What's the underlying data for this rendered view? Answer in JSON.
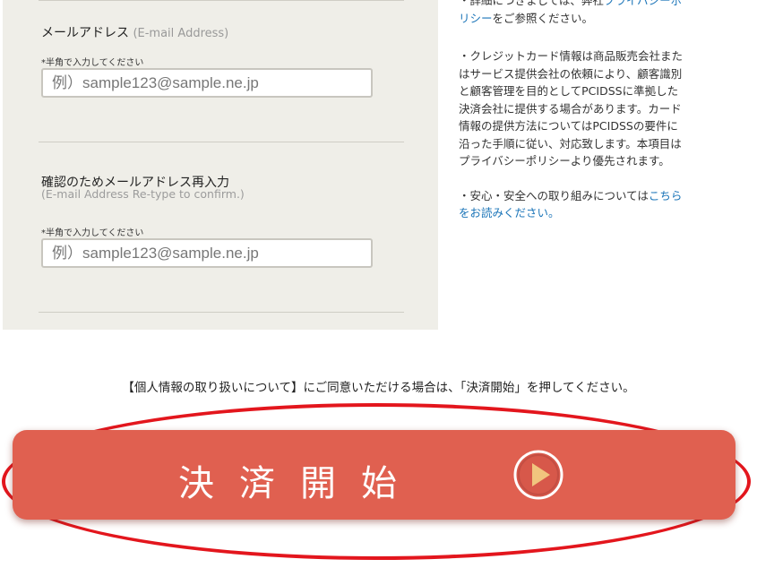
{
  "email_section": {
    "label": "メールアドレス",
    "label_en": "(E-mail Address)",
    "hint": "*半角で入力してください",
    "placeholder": "例）sample123@sample.ne.jp"
  },
  "confirm_section": {
    "label": "確認のためメールアドレス再入力",
    "label_en": "(E-mail Address Re-type to confirm.)",
    "hint": "*半角で入力してください",
    "placeholder": "例）sample123@sample.ne.jp"
  },
  "notes": {
    "privacy_prefix": "・詳細につきましては、弊社",
    "privacy_link": "プライバシーポリシー",
    "privacy_suffix": "をご参照ください。",
    "card_info": "・クレジットカード情報は商品販売会社またはサービス提供会社の依頼により、顧客識別と顧客管理を目的としてPCIDSSに準拠した決済会社に提供する場合があります。カード情報の提供方法についてはPCIDSSの要件に沿った手順に従い、対応致します。本項目はプライバシーポリシーより優先されます。",
    "safety_prefix": "・安心・安全への取り組みについては",
    "safety_link": "こちらをお読みください。"
  },
  "consent_text": "【個人情報の取り扱いについて】にご同意いただける場合は、「決済開始」を押してください。",
  "pay_button": {
    "label": "決済開始",
    "icon": "play-icon"
  },
  "colors": {
    "panel_bg": "#efeee8",
    "button_bg": "#e06050",
    "outline": "#e3161d",
    "link": "#1a74b8",
    "play_fill": "#f1c57e"
  }
}
